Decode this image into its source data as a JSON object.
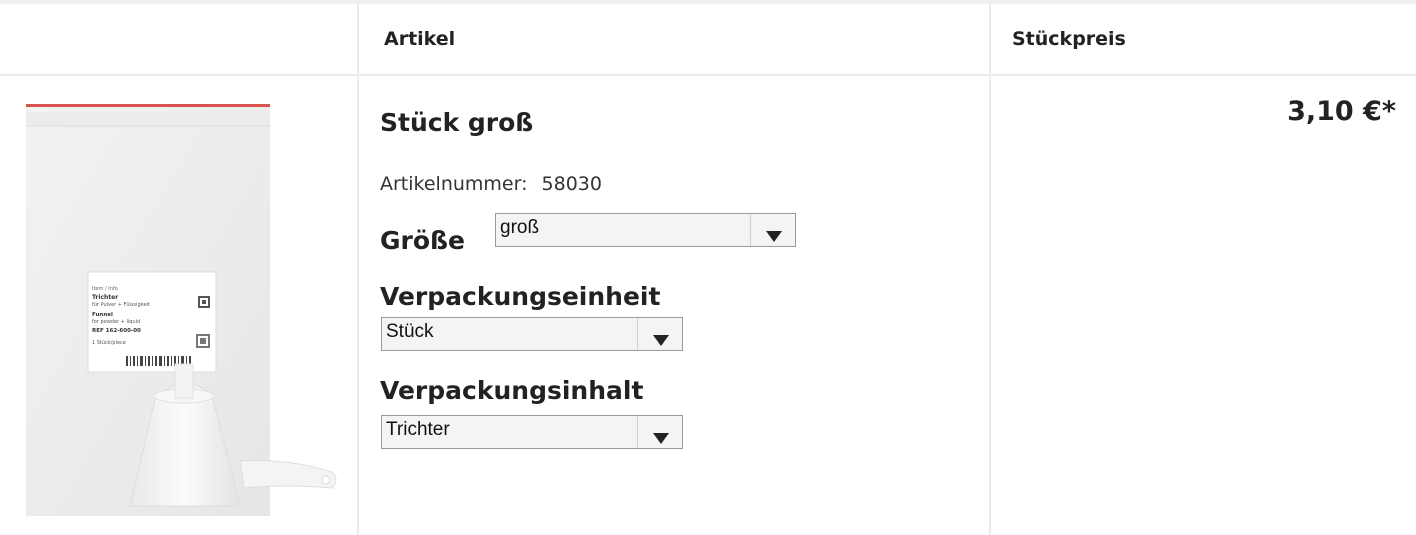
{
  "table": {
    "header": {
      "article_col": "Artikel",
      "price_col": "Stückpreis"
    }
  },
  "product": {
    "title": "Stück groß",
    "article_number_label": "Artikelnummer:",
    "article_number": "58030",
    "price": "3,10 €*",
    "image": {
      "label_lines": [
        "Trichter",
        "für Pulver + Flüssigkeit",
        "Funnel",
        "for powder + liquid",
        "REF 162-600-00",
        "1 Stück/piece"
      ]
    },
    "options": {
      "size": {
        "label": "Größe",
        "selected": "groß"
      },
      "packaging_unit": {
        "label": "Verpackungseinheit",
        "selected": "Stück"
      },
      "packaging_content": {
        "label": "Verpackungsinhalt",
        "selected": "Trichter"
      }
    }
  },
  "colors": {
    "text": "#222222",
    "border": "#ebebeb",
    "bag_seal": "#d9534f",
    "select_bg": "#f4f4f4"
  }
}
